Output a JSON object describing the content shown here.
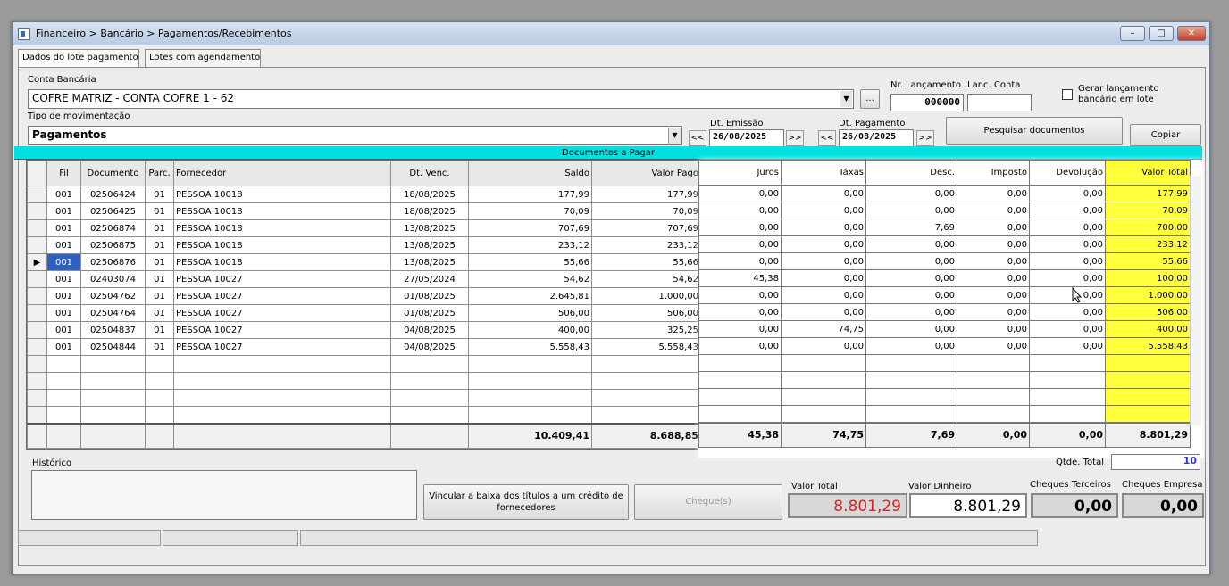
{
  "window": {
    "title": "Financeiro > Bancário > Pagamentos/Recebimentos"
  },
  "tabs": [
    "Dados do lote pagamento",
    "Lotes com agendamento"
  ],
  "conta_bancaria": {
    "label": "Conta Bancária",
    "value": "COFRE MATRIZ - CONTA COFRE 1 - 62",
    "ellipsis": "..."
  },
  "nr_lancamento": {
    "label": "Nr. Lançamento",
    "value": "000000"
  },
  "lanc_conta": {
    "label": "Lanc. Conta",
    "value": ""
  },
  "gerar_lote": {
    "label": "Gerar lançamento bancário em lote"
  },
  "tipo_mov": {
    "label": "Tipo de movimentação",
    "value": "Pagamentos"
  },
  "dt_emissao": {
    "label": "Dt. Emissão",
    "value": "26/08/2025"
  },
  "dt_pagamento": {
    "label": "Dt. Pagamento",
    "value": "26/08/2025"
  },
  "nav": {
    "prev": "<<",
    "next": ">>"
  },
  "buttons": {
    "pesquisar": "Pesquisar documentos",
    "copiar": "Copiar",
    "vincular": "Vincular a baixa dos títulos a um crédito de fornecedores",
    "cheques": "Cheque(s)"
  },
  "grid": {
    "title": "Documentos a Pagar",
    "left_headers": [
      "Fil",
      "Documento",
      "Parc.",
      "Fornecedor",
      "Dt. Venc.",
      "Saldo",
      "Valor Pago"
    ],
    "right_headers": [
      "Juros",
      "Taxas",
      "Desc.",
      "Imposto",
      "Devolução",
      "Valor Total"
    ],
    "rows": [
      {
        "fil": "001",
        "doc": "02506424",
        "parc": "01",
        "forn": "PESSOA 10018",
        "venc": "18/08/2025",
        "saldo": "177,99",
        "pago": "177,99",
        "juros": "0,00",
        "taxas": "0,00",
        "desc": "0,00",
        "imposto": "0,00",
        "dev": "0,00",
        "total": "177,99"
      },
      {
        "fil": "001",
        "doc": "02506425",
        "parc": "01",
        "forn": "PESSOA 10018",
        "venc": "18/08/2025",
        "saldo": "70,09",
        "pago": "70,09",
        "juros": "0,00",
        "taxas": "0,00",
        "desc": "0,00",
        "imposto": "0,00",
        "dev": "0,00",
        "total": "70,09"
      },
      {
        "fil": "001",
        "doc": "02506874",
        "parc": "01",
        "forn": "PESSOA 10018",
        "venc": "13/08/2025",
        "saldo": "707,69",
        "pago": "707,69",
        "juros": "0,00",
        "taxas": "0,00",
        "desc": "7,69",
        "imposto": "0,00",
        "dev": "0,00",
        "total": "700,00"
      },
      {
        "fil": "001",
        "doc": "02506875",
        "parc": "01",
        "forn": "PESSOA 10018",
        "venc": "13/08/2025",
        "saldo": "233,12",
        "pago": "233,12",
        "juros": "0,00",
        "taxas": "0,00",
        "desc": "0,00",
        "imposto": "0,00",
        "dev": "0,00",
        "total": "233,12"
      },
      {
        "fil": "001",
        "doc": "02506876",
        "parc": "01",
        "forn": "PESSOA 10018",
        "venc": "13/08/2025",
        "saldo": "55,66",
        "pago": "55,66",
        "juros": "0,00",
        "taxas": "0,00",
        "desc": "0,00",
        "imposto": "0,00",
        "dev": "0,00",
        "total": "55,66"
      },
      {
        "fil": "001",
        "doc": "02403074",
        "parc": "01",
        "forn": "PESSOA 10027",
        "venc": "27/05/2024",
        "saldo": "54,62",
        "pago": "54,62",
        "juros": "45,38",
        "taxas": "0,00",
        "desc": "0,00",
        "imposto": "0,00",
        "dev": "0,00",
        "total": "100,00"
      },
      {
        "fil": "001",
        "doc": "02504762",
        "parc": "01",
        "forn": "PESSOA 10027",
        "venc": "01/08/2025",
        "saldo": "2.645,81",
        "pago": "1.000,00",
        "juros": "0,00",
        "taxas": "0,00",
        "desc": "0,00",
        "imposto": "0,00",
        "dev": "0,00",
        "total": "1.000,00"
      },
      {
        "fil": "001",
        "doc": "02504764",
        "parc": "01",
        "forn": "PESSOA 10027",
        "venc": "01/08/2025",
        "saldo": "506,00",
        "pago": "506,00",
        "juros": "0,00",
        "taxas": "0,00",
        "desc": "0,00",
        "imposto": "0,00",
        "dev": "0,00",
        "total": "506,00"
      },
      {
        "fil": "001",
        "doc": "02504837",
        "parc": "01",
        "forn": "PESSOA 10027",
        "venc": "04/08/2025",
        "saldo": "400,00",
        "pago": "325,25",
        "juros": "0,00",
        "taxas": "74,75",
        "desc": "0,00",
        "imposto": "0,00",
        "dev": "0,00",
        "total": "400,00"
      },
      {
        "fil": "001",
        "doc": "02504844",
        "parc": "01",
        "forn": "PESSOA 10027",
        "venc": "04/08/2025",
        "saldo": "5.558,43",
        "pago": "5.558,43",
        "juros": "0,00",
        "taxas": "0,00",
        "desc": "0,00",
        "imposto": "0,00",
        "dev": "0,00",
        "total": "5.558,43"
      }
    ],
    "selected_row_index": 4,
    "totals": {
      "saldo": "10.409,41",
      "pago": "8.688,85",
      "juros": "45,38",
      "taxas": "74,75",
      "desc": "7,69",
      "imposto": "0,00",
      "dev": "0,00",
      "total": "8.801,29"
    }
  },
  "historico": {
    "label": "Histórico"
  },
  "qtde_total": {
    "label": "Qtde. Total",
    "value": "10"
  },
  "valor_total": {
    "label": "Valor Total",
    "value": "8.801,29"
  },
  "valor_dinheiro": {
    "label": "Valor Dinheiro",
    "value": "8.801,29"
  },
  "cheques_terceiros": {
    "label": "Cheques Terceiros",
    "value": "0,00"
  },
  "cheques_empresa": {
    "label": "Cheques Empresa",
    "value": "0,00"
  },
  "colors": {
    "grid_header": "#00e0e0",
    "total_highlight": "#ffff3c",
    "valor_total_text": "#e02020",
    "qtde_text": "#2a3adc"
  }
}
